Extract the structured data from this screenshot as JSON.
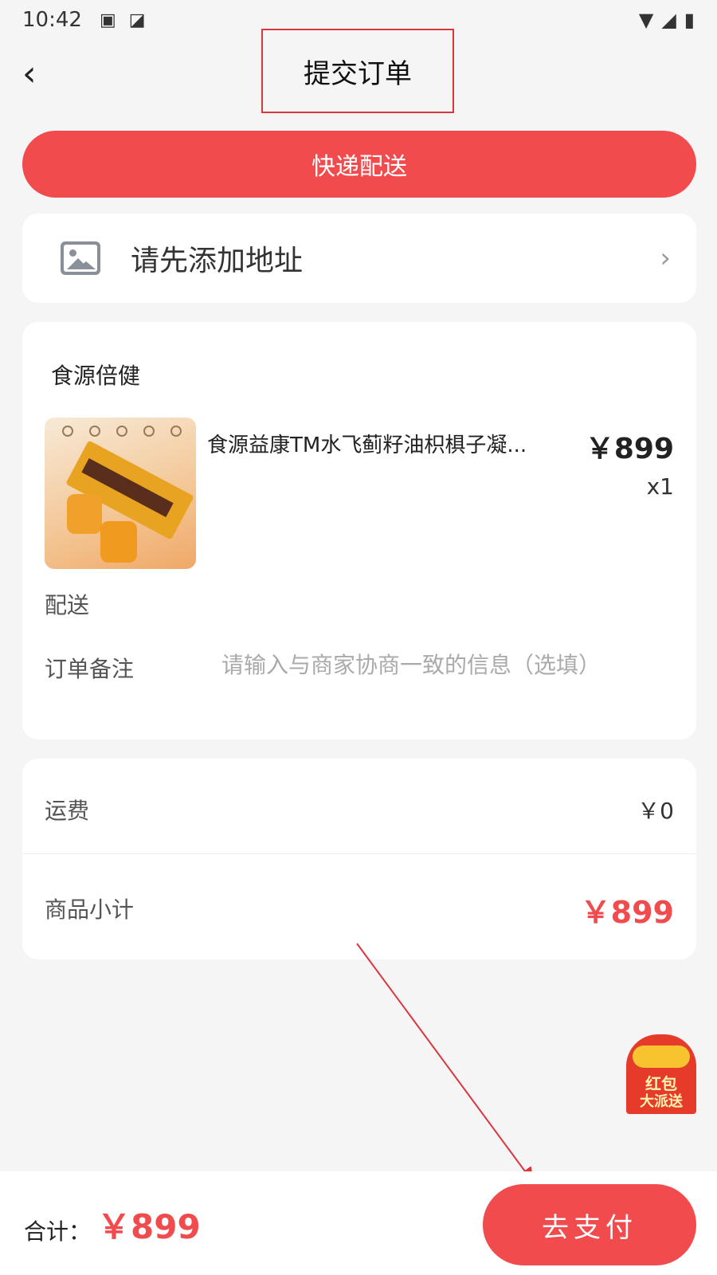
{
  "status_bar": {
    "time": "10:42"
  },
  "header": {
    "title": "提交订单"
  },
  "delivery": {
    "mode_label": "快递配送"
  },
  "address": {
    "prompt": "请先添加地址"
  },
  "order": {
    "shop_name": "食源倍健",
    "product": {
      "name": "食源益康TM水飞蓟籽油枳椇子凝...",
      "price": "￥899",
      "quantity": "x1"
    },
    "shipping_label": "配送",
    "note_label": "订单备注",
    "note_placeholder": "请输入与商家协商一致的信息（选填）"
  },
  "summary": {
    "freight_label": "运费",
    "freight_value": "￥0",
    "subtotal_label": "商品小计",
    "subtotal_value": "￥899"
  },
  "promo": {
    "line1": "红包",
    "line2": "大派送"
  },
  "footer": {
    "total_label": "合计：",
    "total_value": "￥899",
    "pay_button": "去支付"
  },
  "colors": {
    "accent": "#f24b4e",
    "highlight_box": "#d9363e"
  }
}
